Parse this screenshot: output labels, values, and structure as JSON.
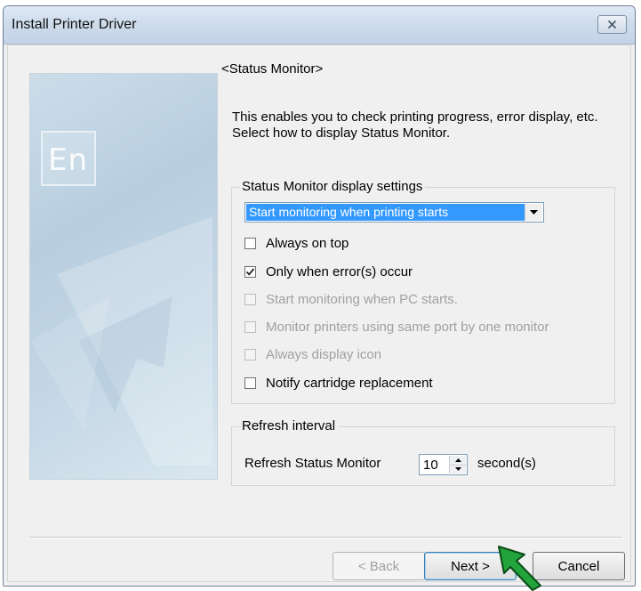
{
  "window": {
    "title": "Install Printer Driver"
  },
  "banner": {
    "logo_text": "En"
  },
  "page": {
    "header": "<Status Monitor>",
    "description_line1": "This enables you to check printing progress, error display, etc.",
    "description_line2": "Select how to display Status Monitor."
  },
  "display_settings": {
    "group_title": "Status Monitor display settings",
    "combo_value": "Start monitoring when printing starts",
    "options": [
      {
        "label": "Always on top",
        "checked": false,
        "enabled": true
      },
      {
        "label": "Only when error(s) occur",
        "checked": true,
        "enabled": true
      },
      {
        "label": "Start monitoring when PC starts.",
        "checked": false,
        "enabled": false
      },
      {
        "label": "Monitor printers using same port by one monitor",
        "checked": false,
        "enabled": false
      },
      {
        "label": "Always display icon",
        "checked": false,
        "enabled": false
      },
      {
        "label": "Notify cartridge replacement",
        "checked": false,
        "enabled": true
      }
    ]
  },
  "refresh": {
    "group_title": "Refresh interval",
    "label": "Refresh Status Monitor",
    "value": "10",
    "unit": "second(s)"
  },
  "buttons": {
    "back": "< Back",
    "next": "Next >",
    "cancel": "Cancel"
  },
  "colors": {
    "selection": "#3399ff",
    "cursor": "#1e9e3a",
    "titlebar": "#cddbeb"
  }
}
